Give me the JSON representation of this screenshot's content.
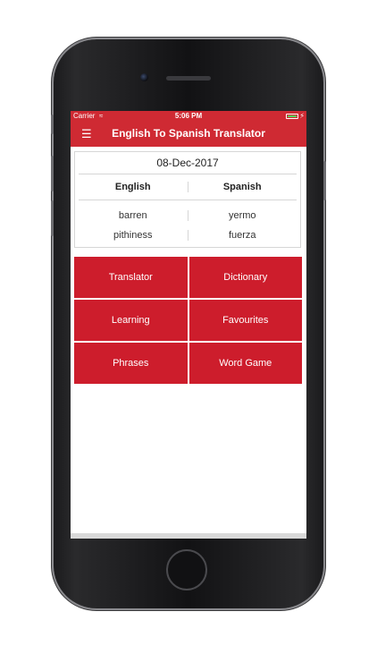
{
  "status": {
    "carrier": "Carrier",
    "time": "5:06 PM"
  },
  "navbar": {
    "title": "English To Spanish Translator",
    "menu_icon": "hamburger-menu-icon"
  },
  "word_card": {
    "date": "08-Dec-2017",
    "headers": {
      "left": "English",
      "right": "Spanish"
    },
    "rows": [
      {
        "english": "barren",
        "spanish": "yermo"
      },
      {
        "english": "pithiness",
        "spanish": "fuerza"
      }
    ]
  },
  "menu": {
    "translator": "Translator",
    "dictionary": "Dictionary",
    "learning": "Learning",
    "favourites": "Favourites",
    "phrases": "Phrases",
    "word_game": "Word Game"
  },
  "colors": {
    "accent": "#cf2a33",
    "tile": "#cd1d2c"
  }
}
